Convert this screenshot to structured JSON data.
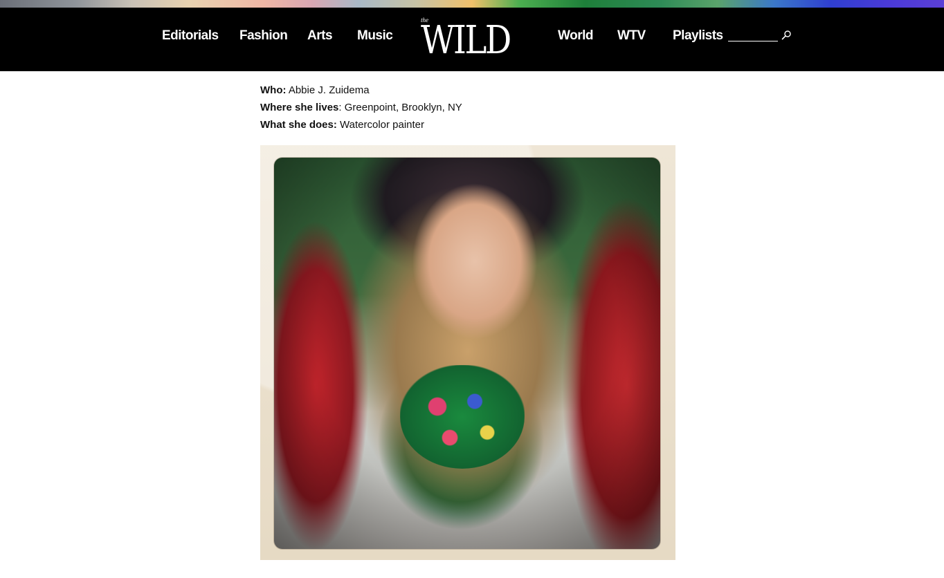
{
  "nav": {
    "left_items": [
      {
        "label": "Editorials"
      },
      {
        "label": "Fashion"
      },
      {
        "label": "Arts"
      },
      {
        "label": "Music"
      }
    ],
    "right_items": [
      {
        "label": "World"
      },
      {
        "label": "WTV"
      },
      {
        "label": "Playlists"
      }
    ],
    "logo": {
      "small_text": "the",
      "word": "WILD"
    },
    "search": {
      "placeholder": "",
      "icon": "search-icon"
    }
  },
  "profile": {
    "who": {
      "label": "Who:",
      "value": " Abbie J. Zuidema"
    },
    "lives": {
      "label": "Where she lives",
      "value": ": Greenpoint, Brooklyn, NY"
    },
    "does": {
      "label": "What she does:",
      "value": " Watercolor painter"
    }
  },
  "colors": {
    "nav_bg": "#000000",
    "nav_text": "#ffffff",
    "page_bg": "#ffffff"
  }
}
